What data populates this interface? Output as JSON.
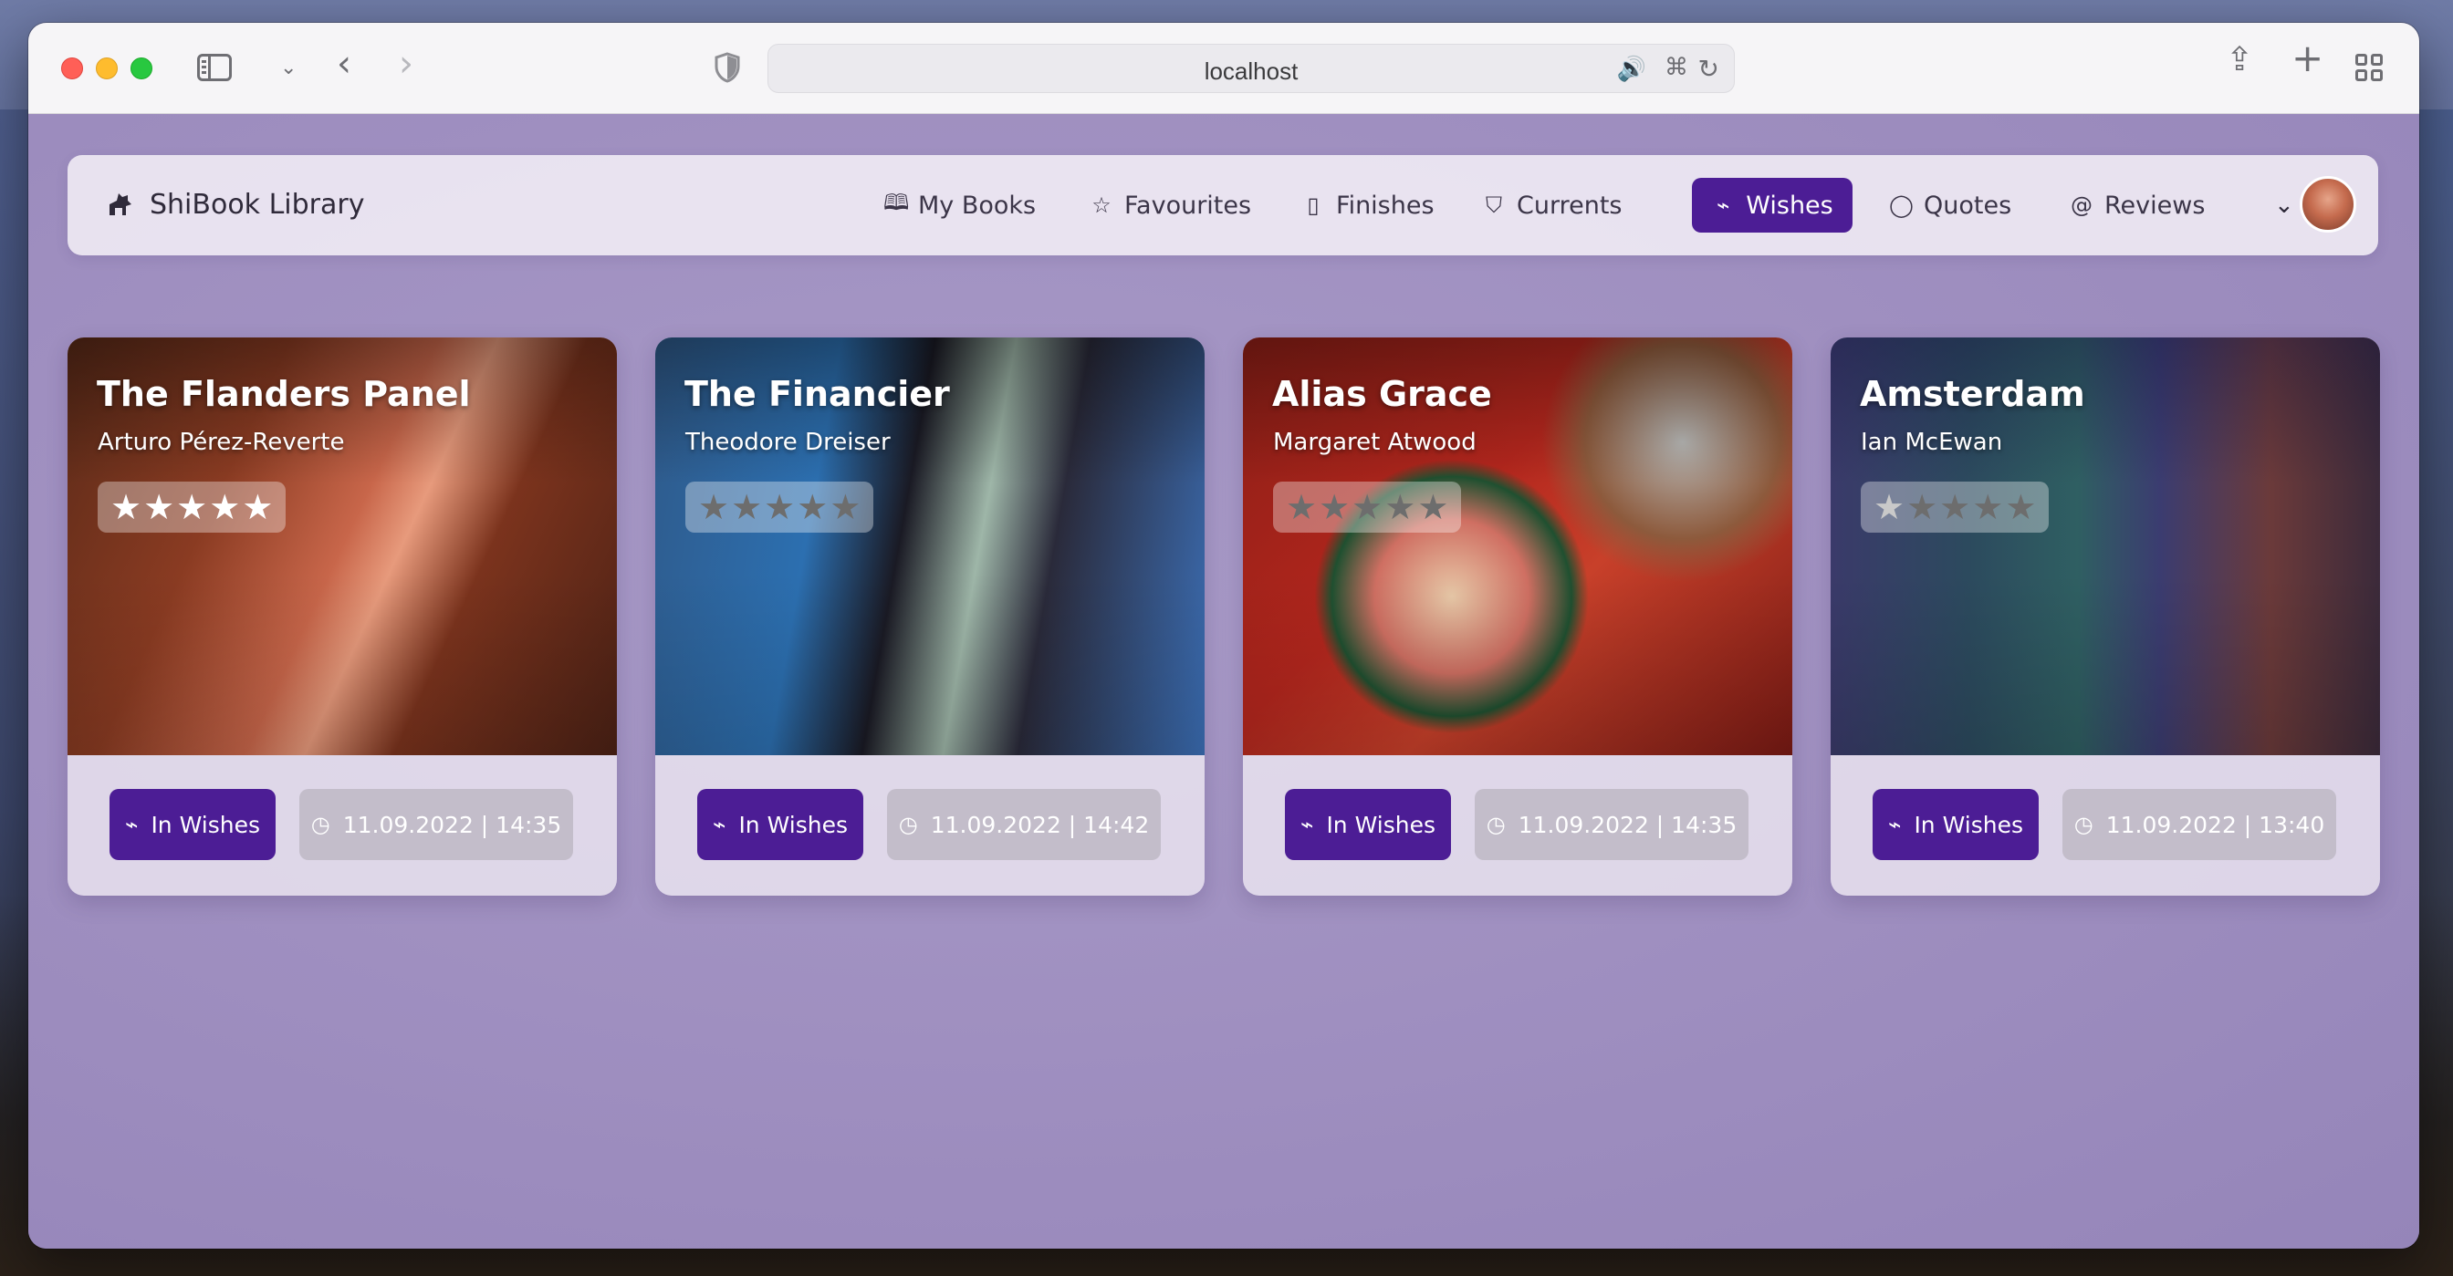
{
  "browser": {
    "url": "localhost"
  },
  "app": {
    "brand": "ShiBook Library",
    "nav": [
      {
        "label": "My Books",
        "icon": "book-open-icon"
      },
      {
        "label": "Favourites",
        "icon": "star-icon"
      },
      {
        "label": "Finishes",
        "icon": "book-icon"
      },
      {
        "label": "Currents",
        "icon": "bookmark-icon"
      },
      {
        "label": "Wishes",
        "icon": "activity-icon",
        "active": true
      },
      {
        "label": "Quotes",
        "icon": "message-circle-icon"
      },
      {
        "label": "Reviews",
        "icon": "at-sign-icon"
      }
    ],
    "accent_color": "#4c1d95"
  },
  "books": [
    {
      "title": "The Flanders Panel",
      "author": "Arturo Pérez-Reverte",
      "rating": 5,
      "status": "In Wishes",
      "date": "11.09.2022 | 14:35"
    },
    {
      "title": "The Financier",
      "author": "Theodore Dreiser",
      "rating": 0,
      "status": "In Wishes",
      "date": "11.09.2022 | 14:42"
    },
    {
      "title": "Alias Grace",
      "author": "Margaret Atwood",
      "rating": 0,
      "status": "In Wishes",
      "date": "11.09.2022 | 14:35"
    },
    {
      "title": "Amsterdam",
      "author": "Ian McEwan",
      "rating": 1,
      "status": "In Wishes",
      "date": "11.09.2022 | 13:40"
    }
  ]
}
